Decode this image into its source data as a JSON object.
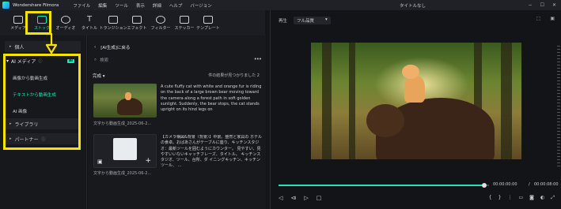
{
  "app": {
    "name": "Wondershare Filmora",
    "doc_title": "タイトルなし"
  },
  "menu": [
    "ファイル",
    "編集",
    "ツール",
    "表示",
    "詳細",
    "ヘルプ",
    "バージョン"
  ],
  "toolbar": [
    {
      "label": "メディア",
      "icon": "media-icon"
    },
    {
      "label": "ストック",
      "icon": "stock-icon",
      "active": true
    },
    {
      "label": "オーディオ",
      "icon": "audio-icon"
    },
    {
      "label": "タイトル",
      "icon": "title-icon"
    },
    {
      "label": "トランジション",
      "icon": "transition-icon"
    },
    {
      "label": "エフェクト",
      "icon": "effect-icon"
    },
    {
      "label": "フィルター",
      "icon": "filter-icon"
    },
    {
      "label": "ステッカー",
      "icon": "sticker-icon"
    },
    {
      "label": "テンプレート",
      "icon": "template-icon"
    }
  ],
  "sidebar": {
    "personal": "個人",
    "ai_media": "AI メディア",
    "ai_badge": "AI",
    "ai_items": [
      "画像から動画生成",
      "テキストから動画生成",
      "AI 画像"
    ],
    "library": "ライブラリ",
    "partner": "パートナー"
  },
  "browser": {
    "back_title": "[AI生成]に戻る",
    "search_placeholder": "検索",
    "filter_label": "完成",
    "result_count": "件の結果が見つかりました 2",
    "cards": [
      {
        "description": "A cute fluffy cat with white and orange fur is riding on the back of a large brown bear moving toward the camera along a forest path in soft golden sunlight. Suddenly, the bear stops, the cat stands upright on its hind legs on",
        "caption": "文字から動画生成_2025-06-2..."
      },
      {
        "description": "【カメラ構図&背景（背景）】中景。整然と家具の ホテルの食卓。おばあさんがテーブルに座り、キッチンスタジオ：最新ツールを囲むようにカウンター。 見やすい、見やすいいないキャッチフレーズ、タイトル。 キッチンスタジオ、ツール、台所、ダ イニングキッチン、キッチンツール、 ...",
        "caption": "文字から動画生成_2025-06-2..."
      }
    ]
  },
  "player": {
    "label": "再生",
    "quality": "フル品質",
    "current_time": "00:00:00:00",
    "separator": "/",
    "total_time": "00:00:08:00",
    "progress": 0.97
  },
  "colors": {
    "accent": "#1de9b6",
    "highlight": "#f5e300"
  }
}
